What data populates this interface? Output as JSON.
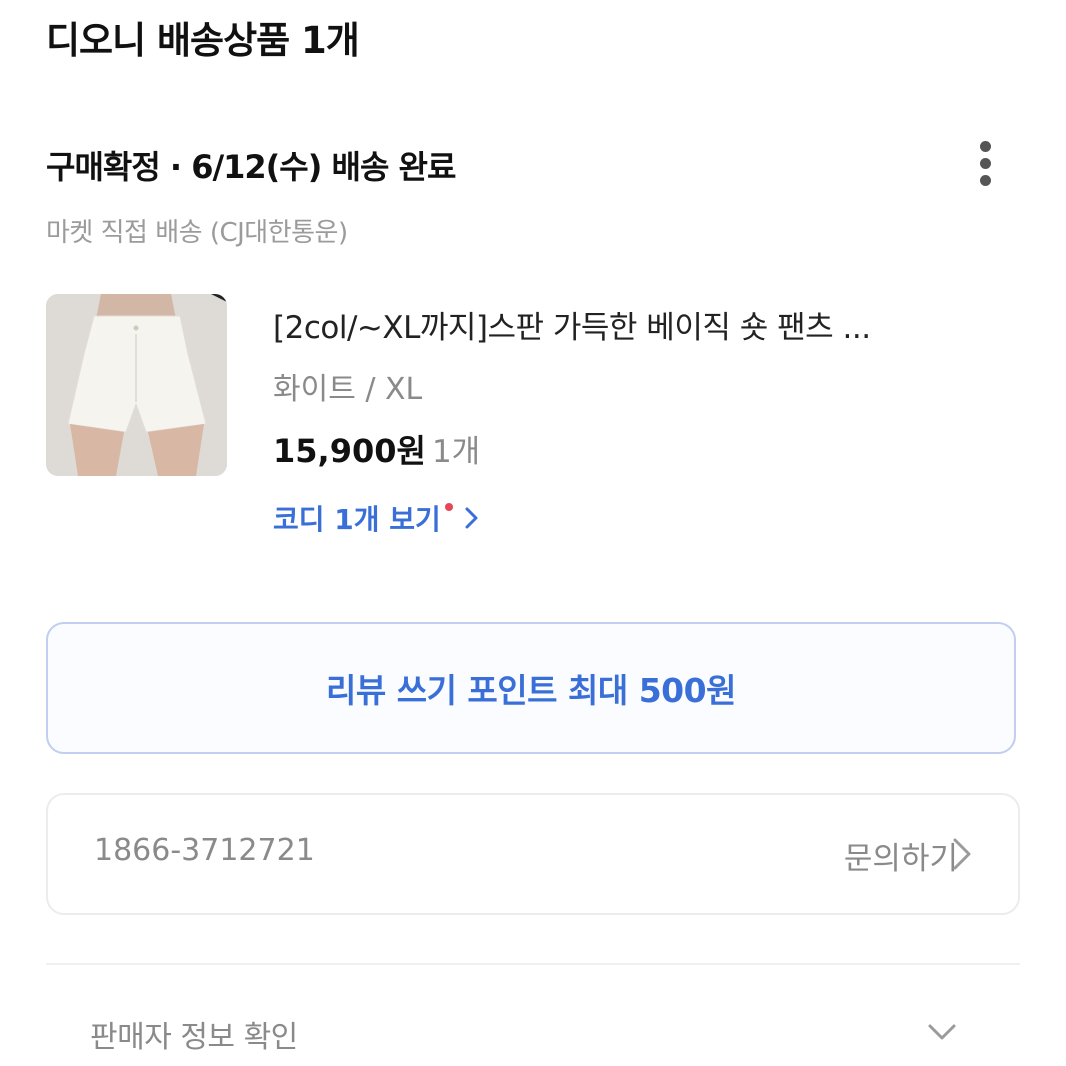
{
  "header": {
    "title": "디오니 배송상품 1개"
  },
  "order": {
    "status": "구매확정 · 6/12(수) 배송 완료",
    "shipping": "마켓 직접 배송 (CJ대한통운)"
  },
  "product": {
    "name": "[2col/~XL까지]스판 가득한 베이직 숏 팬츠 ...",
    "option": "화이트 / XL",
    "price": "15,900원",
    "quantity": "1개",
    "codi_link": "코디 1개 보기"
  },
  "review_button": {
    "label": "리뷰 쓰기 포인트 최대 500원"
  },
  "contact": {
    "phone": "1866-3712721",
    "inquiry_label": "문의하기"
  },
  "seller": {
    "label": "판매자 정보 확인"
  },
  "colors": {
    "accent": "#3a6fd8",
    "notification_dot": "#e8455a",
    "muted_text": "#8a8a8a"
  },
  "icons": {
    "more": "more-vertical-icon",
    "codi_chevron": "chevron-right-icon",
    "contact_chevron": "chevron-right-icon",
    "seller_toggle": "chevron-down-icon"
  }
}
